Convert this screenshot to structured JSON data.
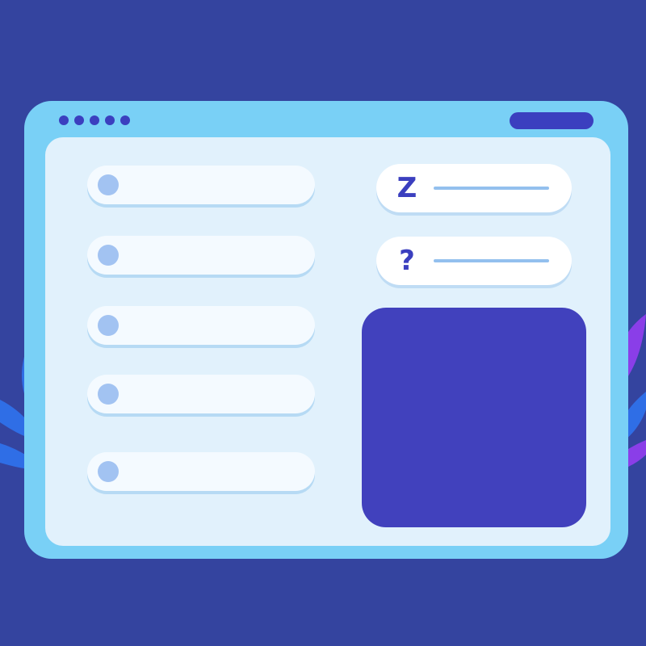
{
  "window": {
    "dots": [
      "dot",
      "dot",
      "dot",
      "dot",
      "dot"
    ]
  },
  "list": {
    "items": [
      {
        "bullet": "circle"
      },
      {
        "bullet": "circle"
      },
      {
        "bullet": "circle"
      },
      {
        "bullet": "circle"
      },
      {
        "bullet": "circle"
      }
    ]
  },
  "cards": [
    {
      "glyph": "Z",
      "icon": "sleep-z-icon"
    },
    {
      "glyph": "?",
      "icon": "question-mark-icon"
    }
  ],
  "colors": {
    "background": "#34449f",
    "frame": "#79d0f6",
    "panel": "#e1f1fc",
    "accent": "#3b3fbf",
    "media": "#4141bd",
    "leaf_blue": "#2f6ee6",
    "leaf_purple": "#8a3ee8"
  }
}
